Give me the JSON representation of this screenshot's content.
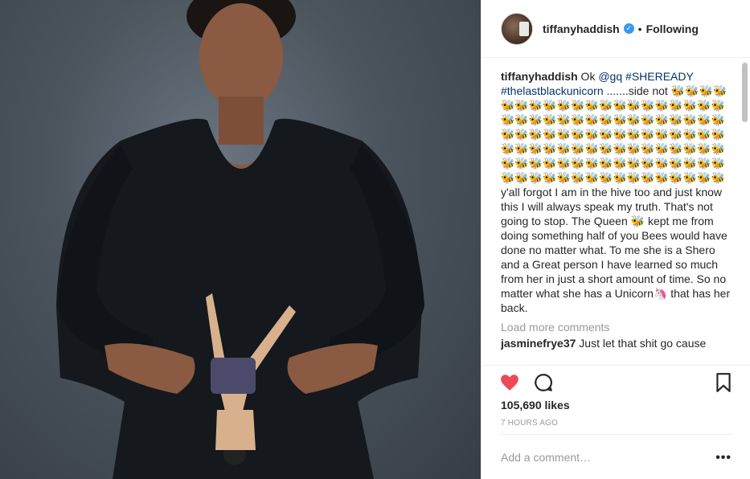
{
  "post": {
    "username": "tiffanyhaddish",
    "following_label": "Following",
    "dot": "•",
    "verified_glyph": "✓"
  },
  "caption": {
    "username": "tiffanyhaddish",
    "text_1": " Ok ",
    "mention": "@gq",
    "text_2": " ",
    "hashtag_1": "#SHEREADY",
    "text_3": " ",
    "hashtag_2": "#thelastblackunicorn",
    "text_4": " .......side not ",
    "bees": "🐝🐝🐝🐝🐝🐝🐝🐝🐝🐝🐝🐝🐝🐝🐝🐝🐝🐝🐝🐝🐝🐝🐝🐝🐝🐝🐝🐝🐝🐝🐝🐝🐝🐝🐝🐝🐝🐝🐝🐝🐝🐝🐝🐝🐝🐝🐝🐝🐝🐝🐝🐝🐝🐝🐝🐝🐝🐝🐝🐝🐝🐝🐝🐝🐝🐝🐝🐝🐝🐝🐝🐝🐝🐝🐝🐝🐝🐝🐝🐝🐝🐝🐝🐝🐝🐝🐝🐝🐝🐝🐝🐝🐝🐝🐝🐝🐝🐝🐝🐝",
    "text_5": " y'all forgot I am in the hive too and just know this I will always speak my truth. That's not going to stop. The Queen 🐝 kept me from doing something half of you Bees would have done no matter what. To me she is a Shero and a Great person I have learned so much from her in just a short amount of time. So no matter what she has a Unicorn🦄 that has her back."
  },
  "comments": {
    "load_more": "Load more comments",
    "next_user": "jasminefrye37",
    "next_text": " Just let that shit go cause"
  },
  "stats": {
    "likes": "105,690 likes",
    "time": "7 HOURS AGO"
  },
  "add_comment": {
    "placeholder": "Add a comment…",
    "more": "•••"
  },
  "colors": {
    "heart": "#ed4956",
    "link": "#003569",
    "muted": "#999999",
    "verified": "#3897f0"
  },
  "icons": [
    "heart-icon",
    "comment-icon",
    "bookmark-icon",
    "verified-icon",
    "more-icon"
  ]
}
